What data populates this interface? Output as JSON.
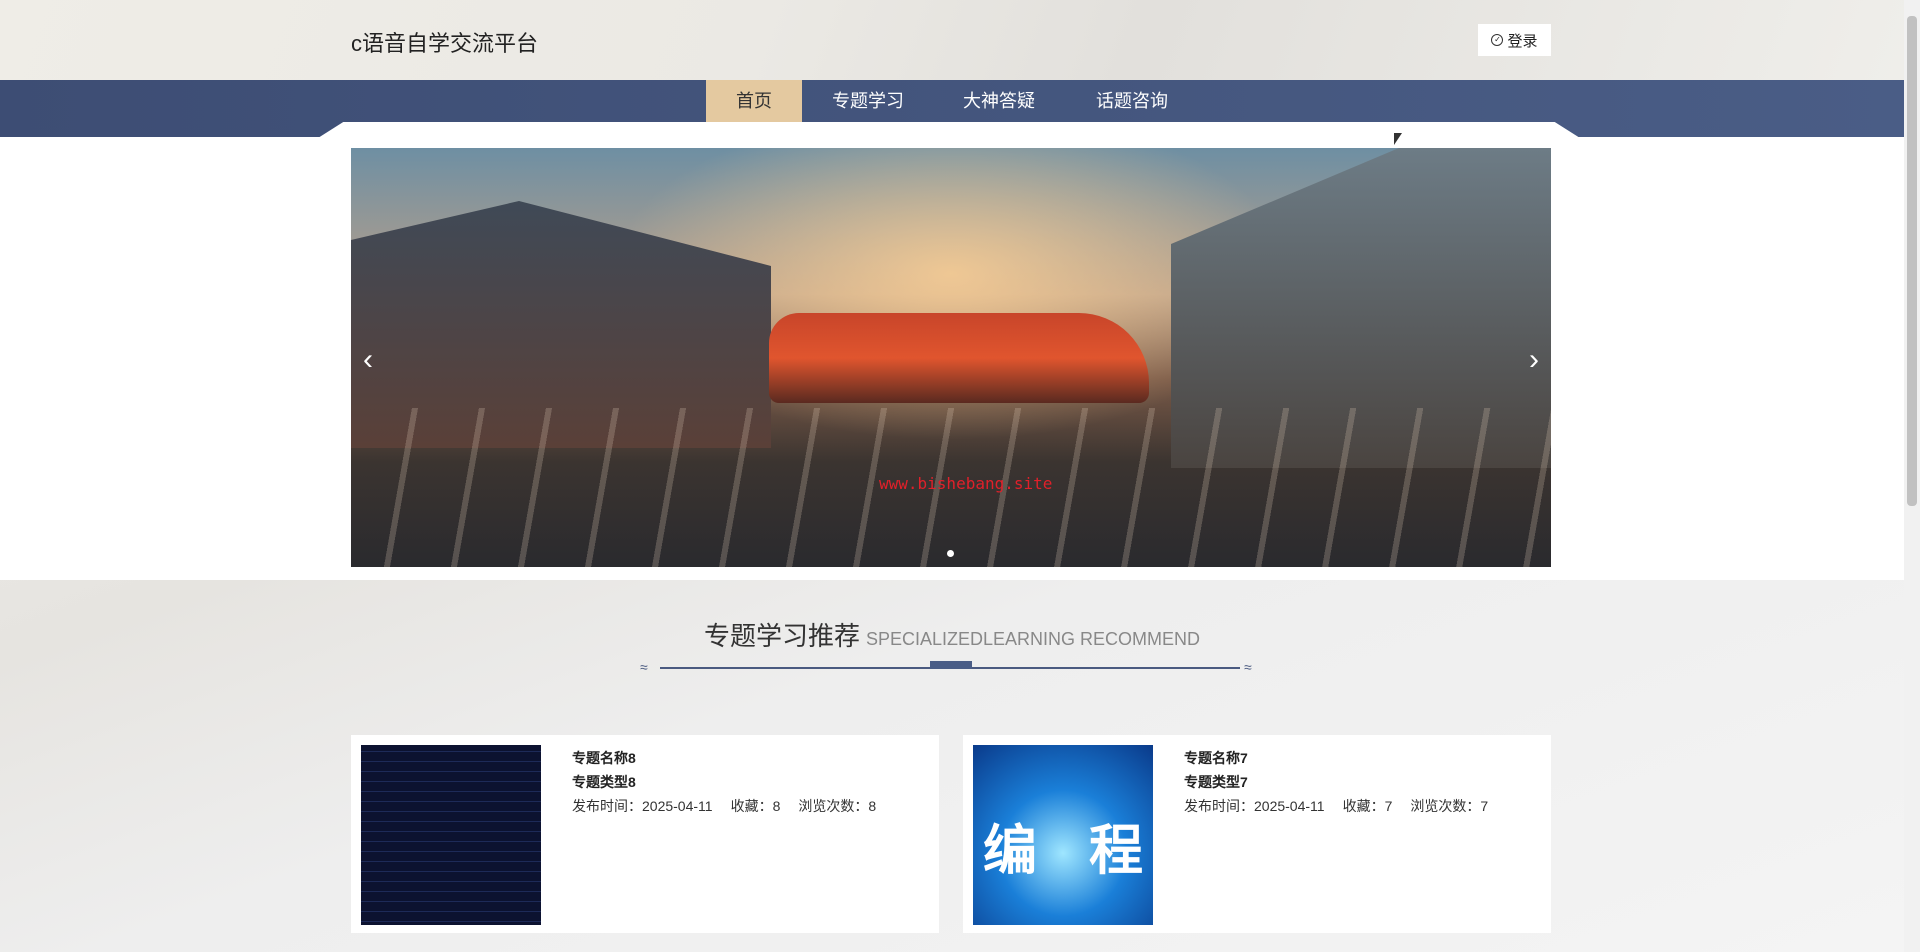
{
  "header": {
    "site_title": "c语音自学交流平台",
    "login_label": "登录",
    "login_icon": "check-circle-icon"
  },
  "nav": {
    "items": [
      {
        "label": "首页",
        "active": true
      },
      {
        "label": "专题学习",
        "active": false
      },
      {
        "label": "大神答疑",
        "active": false
      },
      {
        "label": "话题咨询",
        "active": false
      }
    ]
  },
  "carousel": {
    "watermark": "www.bishebang.site",
    "prev_icon": "chevron-left-icon",
    "next_icon": "chevron-right-icon",
    "current_slide": 1,
    "slide_count": 1
  },
  "section": {
    "title_cn": "专题学习推荐",
    "title_en": "SPECIALIZEDLEARNING RECOMMEND"
  },
  "cards": [
    {
      "name": "专题名称8",
      "type": "专题类型8",
      "publish": "发布时间：2025-04-11",
      "favorites": "收藏：8",
      "views": "浏览次数：8"
    },
    {
      "name": "专题名称7",
      "type": "专题类型7",
      "publish": "发布时间：2025-04-11",
      "favorites": "收藏：7",
      "views": "浏览次数：7",
      "image_text_left": "编",
      "image_text_right": "程"
    }
  ],
  "colors": {
    "nav_bg": "#3d4d74",
    "nav_active": "#e4c9a0"
  }
}
